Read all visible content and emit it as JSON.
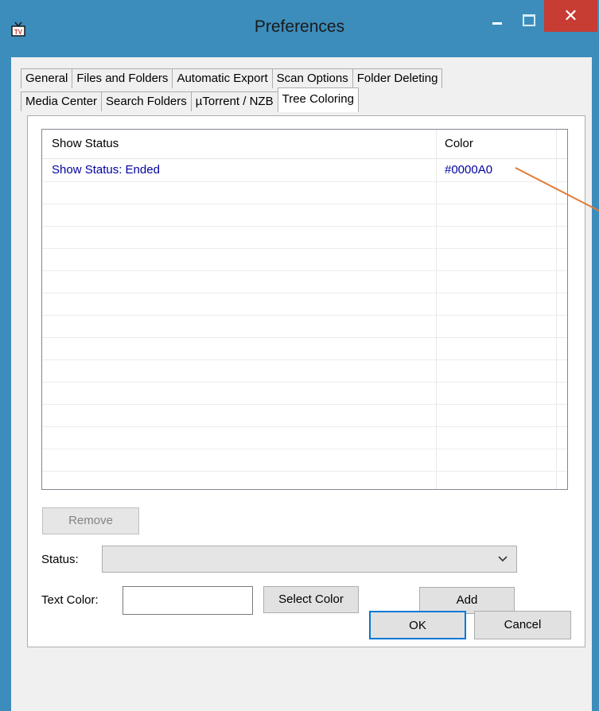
{
  "window": {
    "title": "Preferences",
    "icon": "tv-icon",
    "controls": {
      "minimize": "minimize-icon",
      "maximize": "maximize-icon",
      "close": "✕"
    }
  },
  "tabs": {
    "row1": [
      "General",
      "Files and Folders",
      "Automatic Export",
      "Scan Options",
      "Folder Deleting"
    ],
    "row2": [
      "Media Center",
      "Search Folders",
      "µTorrent / NZB",
      "Tree Coloring"
    ],
    "active": "Tree Coloring"
  },
  "list": {
    "columns": {
      "status": "Show Status",
      "color": "Color"
    },
    "rows": [
      {
        "status": "Show Status: Ended",
        "color": "#0000A0"
      }
    ]
  },
  "form": {
    "remove_label": "Remove",
    "status_label": "Status:",
    "status_value": "",
    "text_color_label": "Text Color:",
    "text_color_value": "",
    "select_color_label": "Select Color",
    "add_label": "Add"
  },
  "footer": {
    "ok_label": "OK",
    "cancel_label": "Cancel"
  },
  "colors": {
    "titlebar": "#3C8DBC",
    "close": "#C73C33",
    "row_text": "#0000A0",
    "annotation_arrow": "#E07B39"
  }
}
